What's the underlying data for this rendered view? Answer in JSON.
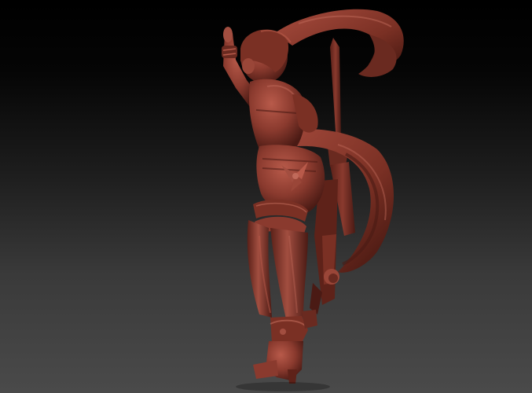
{
  "scene": {
    "subject": "sculpt-figure",
    "material_colors": {
      "base": "#8a3a2e",
      "highlight": "#b4584a",
      "shadow": "#4a1a14",
      "deep_shadow": "#2e0e0a"
    },
    "background": {
      "top": "#000000",
      "bottom": "#4a4a4a"
    }
  }
}
